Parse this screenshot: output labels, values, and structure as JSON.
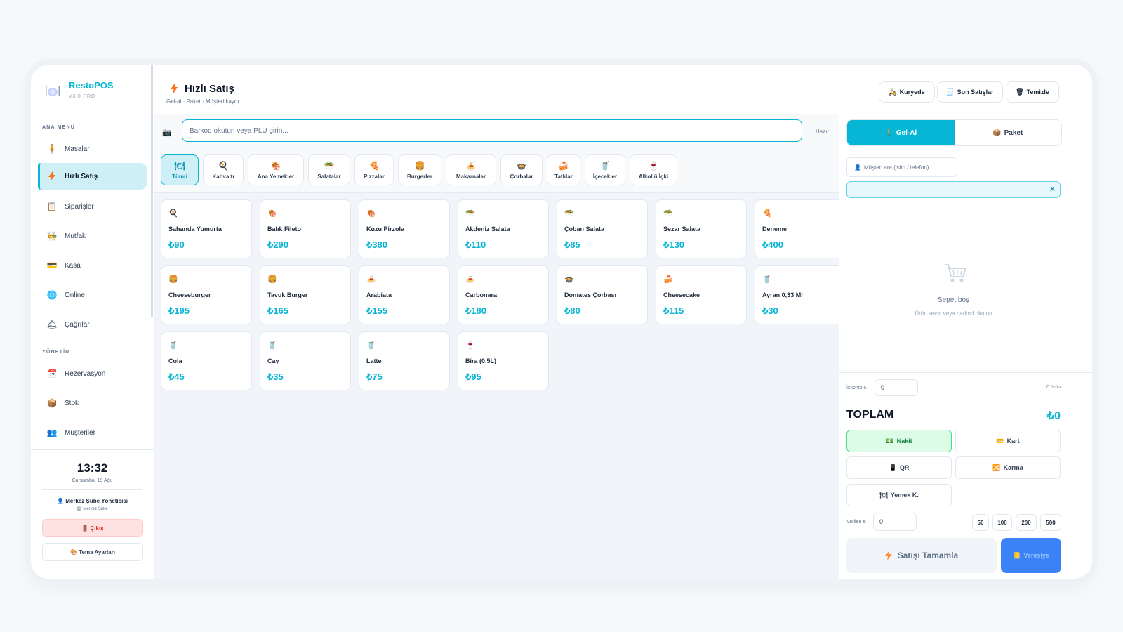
{
  "app": {
    "name": "RestoPOS",
    "version": "V3.0 PRO"
  },
  "sidebar": {
    "main_title": "ANA MENÜ",
    "main_items": [
      {
        "label": "Masalar",
        "icon": "person-icon"
      },
      {
        "label": "Hızlı Satış",
        "icon": "bolt-icon",
        "active": true
      },
      {
        "label": "Siparişler",
        "icon": "clipboard-icon"
      },
      {
        "label": "Mutfak",
        "icon": "chef-icon"
      },
      {
        "label": "Kasa",
        "icon": "card-icon"
      },
      {
        "label": "Online",
        "icon": "globe-icon"
      },
      {
        "label": "Çağrılar",
        "icon": "bell-icon"
      }
    ],
    "admin_title": "YÖNETİM",
    "admin_items": [
      {
        "label": "Rezervasyon",
        "icon": "calendar-icon"
      },
      {
        "label": "Stok",
        "icon": "box-icon"
      },
      {
        "label": "Müşteriler",
        "icon": "users-icon"
      }
    ],
    "clock": "13:32",
    "date": "Çarşamba, 19 Ağu",
    "user": "Merkez Şube Yöneticisi",
    "branch": "Merkez Şube",
    "logout": "Çıkış",
    "theme": "Tema Ayarları"
  },
  "header": {
    "title": "Hızlı Satış",
    "subtitle": "Gel-al · Paket · Müşteri kaydı",
    "buttons": [
      "Kuryede",
      "Son Satışlar",
      "Temizle"
    ]
  },
  "scan": {
    "placeholder": "Barkod okutun veya PLU girin...",
    "status": "Hazır"
  },
  "categories": [
    {
      "label": "Tümü",
      "icon": "🍽",
      "active": true
    },
    {
      "label": "Kahvaltı",
      "icon": "🍳"
    },
    {
      "label": "Ana Yemekler",
      "icon": "🍖"
    },
    {
      "label": "Salatalar",
      "icon": "🥗"
    },
    {
      "label": "Pizzalar",
      "icon": "🍕"
    },
    {
      "label": "Burgerler",
      "icon": "🍔"
    },
    {
      "label": "Makarnalar",
      "icon": "🍝"
    },
    {
      "label": "Çorbalar",
      "icon": "🍲"
    },
    {
      "label": "Tatlılar",
      "icon": "🍰"
    },
    {
      "label": "İçecekler",
      "icon": "🥤"
    },
    {
      "label": "Alkollü İçki",
      "icon": "🍷"
    }
  ],
  "products": [
    {
      "name": "Sahanda Yumurta",
      "price": "₺90",
      "icon": "🍳"
    },
    {
      "name": "Balık Fileto",
      "price": "₺290",
      "icon": "🍖"
    },
    {
      "name": "Kuzu Pirzola",
      "price": "₺380",
      "icon": "🍖"
    },
    {
      "name": "Akdeniz Salata",
      "price": "₺110",
      "icon": "🥗"
    },
    {
      "name": "Çoban Salata",
      "price": "₺85",
      "icon": "🥗"
    },
    {
      "name": "Sezar Salata",
      "price": "₺130",
      "icon": "🥗"
    },
    {
      "name": "Deneme",
      "price": "₺400",
      "icon": "🍕"
    },
    {
      "name": "Cheeseburger",
      "price": "₺195",
      "icon": "🍔"
    },
    {
      "name": "Tavuk Burger",
      "price": "₺165",
      "icon": "🍔"
    },
    {
      "name": "Arabiata",
      "price": "₺155",
      "icon": "🍝"
    },
    {
      "name": "Carbonara",
      "price": "₺180",
      "icon": "🍝"
    },
    {
      "name": "Domates Çorbası",
      "price": "₺80",
      "icon": "🍲"
    },
    {
      "name": "Cheesecake",
      "price": "₺115",
      "icon": "🍰"
    },
    {
      "name": "Ayran 0,33 Ml",
      "price": "₺30",
      "icon": "🥤"
    },
    {
      "name": "Cola",
      "price": "₺45",
      "icon": "🥤"
    },
    {
      "name": "Çay",
      "price": "₺35",
      "icon": "🥤"
    },
    {
      "name": "Latte",
      "price": "₺75",
      "icon": "🥤"
    },
    {
      "name": "Bira (0.5L)",
      "price": "₺95",
      "icon": "🍷"
    }
  ],
  "panel": {
    "tabs": [
      {
        "label": "Gel-Al",
        "active": true
      },
      {
        "label": "Paket"
      }
    ],
    "customer_placeholder": "Müşteri ara (isim / telefon)...",
    "empty_title": "Sepet boş",
    "empty_sub": "Ürün seçin veya barkod okutun",
    "discount_label": "İskonto ₺",
    "discount_value": "0",
    "item_count": "0 ürün",
    "total_label": "TOPLAM",
    "total_value": "₺0",
    "payments": [
      {
        "label": "Nakit",
        "active": true
      },
      {
        "label": "Kart"
      },
      {
        "label": "QR"
      },
      {
        "label": "Karma"
      },
      {
        "label": "Yemek K."
      }
    ],
    "given_label": "Verilen ₺",
    "given_value": "0",
    "quick_amounts": [
      "50",
      "100",
      "200",
      "500"
    ],
    "complete_label": "Satışı Tamamla",
    "credit_label": "Veresiye"
  }
}
